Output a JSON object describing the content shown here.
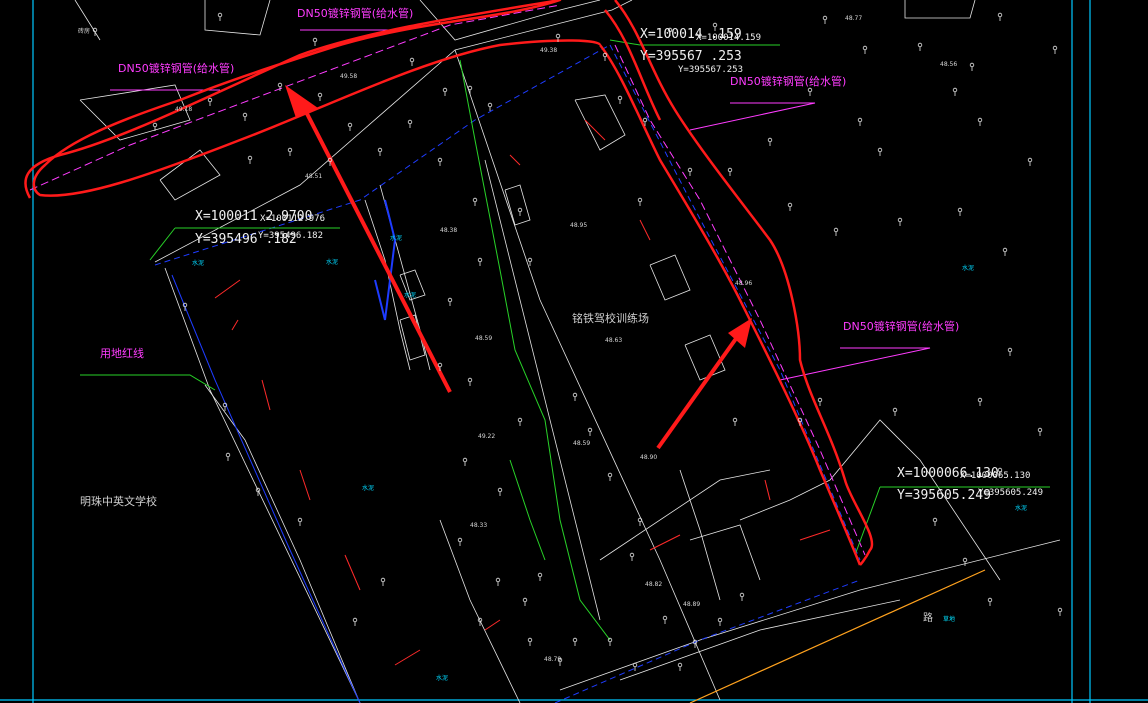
{
  "window": {
    "title": "",
    "colors": {
      "background": "#000000",
      "frame": "#00c8ff",
      "blue_line": "#1e3cff",
      "magenta_pipe": "#ff3cff",
      "green_leader": "#28d228",
      "red_markup": "#ff1a1a",
      "white_lines": "#e6e6e6",
      "orange_road": "#ffa21e"
    }
  },
  "pipe_labels": {
    "top_center": "DN50镀锌钢管(给水管)",
    "top_left": "DN50镀锌钢管(给水管)",
    "right_upper": "DN50镀锌钢管(给水管)",
    "right_middle": "DN50镀锌钢管(给水管)"
  },
  "redline_label": "用地红线",
  "site_name": "铭铁驾校训练场",
  "school_name": "明珠中英文学校",
  "road_label": "路",
  "coordinates": {
    "top_right": {
      "x": "X=100014 .159",
      "y": "Y=395567 .253",
      "x_small": "X=100014.159",
      "y_small": "Y=395567.253"
    },
    "left": {
      "x": "X=100011 2.9700",
      "y": "Y=395496 .182",
      "x_small": "X=100112.976",
      "y_small": "Y=395496.182"
    },
    "bottom_right": {
      "x": "X=1000066.130",
      "y": "Y=395605.249",
      "x_small": "X=1000065.130",
      "y_small": "Y=395605.249"
    }
  },
  "elevations": [
    "49.18",
    "49.58",
    "48.51",
    "48.38",
    "48.59",
    "49.22",
    "48.33",
    "48.79",
    "48.82",
    "48.56",
    "48.77",
    "49.38",
    "48.95",
    "48.63",
    "48.59",
    "48.90",
    "48.96",
    "48.89"
  ],
  "small_labels": {
    "top_left_building": "砖房",
    "school_mark": "水泥",
    "grass": "草地"
  }
}
